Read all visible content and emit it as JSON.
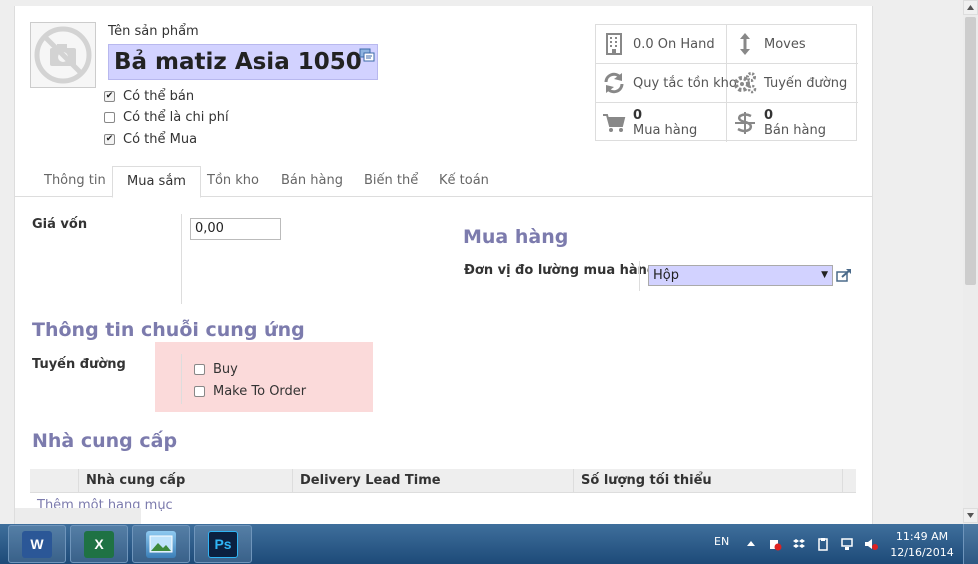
{
  "header": {
    "product_label": "Tên sản phẩm",
    "product_name": "Bả matiz Asia 1050",
    "flags": [
      {
        "label": "Có thể bán",
        "checked": true
      },
      {
        "label": "Có thể là chi phí",
        "checked": false
      },
      {
        "label": "Có thể Mua",
        "checked": true
      }
    ]
  },
  "stats": [
    {
      "label": "0.0 On Hand",
      "icon": "building-icon"
    },
    {
      "label": "Moves",
      "icon": "arrows-vertical-icon"
    },
    {
      "label": "Quy tắc tồn kho",
      "icon": "refresh-icon"
    },
    {
      "label": "Tuyến đường",
      "icon": "gears-icon"
    },
    {
      "number": "0",
      "label": "Mua hàng",
      "icon": "cart-icon"
    },
    {
      "number": "0",
      "label": "Bán hàng",
      "icon": "dollar-icon"
    }
  ],
  "tabs": [
    "Thông tin",
    "Mua sắm",
    "Tồn kho",
    "Bán hàng",
    "Biến thể",
    "Kế toán"
  ],
  "active_tab": "Mua sắm",
  "cost": {
    "label": "Giá vốn",
    "value": "0,00"
  },
  "purchase": {
    "title": "Mua hàng",
    "uom_label": "Đơn vị đo lường mua hàng",
    "uom_value": "Hộp"
  },
  "supply_chain": {
    "title": "Thông tin chuỗi cung ứng",
    "routes_label": "Tuyến đường",
    "routes": [
      {
        "label": "Buy",
        "checked": false
      },
      {
        "label": "Make To Order",
        "checked": false
      }
    ]
  },
  "suppliers": {
    "title": "Nhà cung cấp",
    "columns": [
      "Nhà cung cấp",
      "Delivery Lead Time",
      "Số lượng tối thiểu"
    ],
    "add_item": "Thêm một hạng mục"
  },
  "taskbar": {
    "apps": [
      "word-icon",
      "excel-icon",
      "photo-viewer-icon",
      "photoshop-icon"
    ],
    "lang": "EN",
    "time": "11:49 AM",
    "date": "12/16/2014"
  },
  "colors": {
    "accent": "#7c7bad",
    "required_field": "#d2d2ff",
    "highlight": "#fbdada"
  }
}
